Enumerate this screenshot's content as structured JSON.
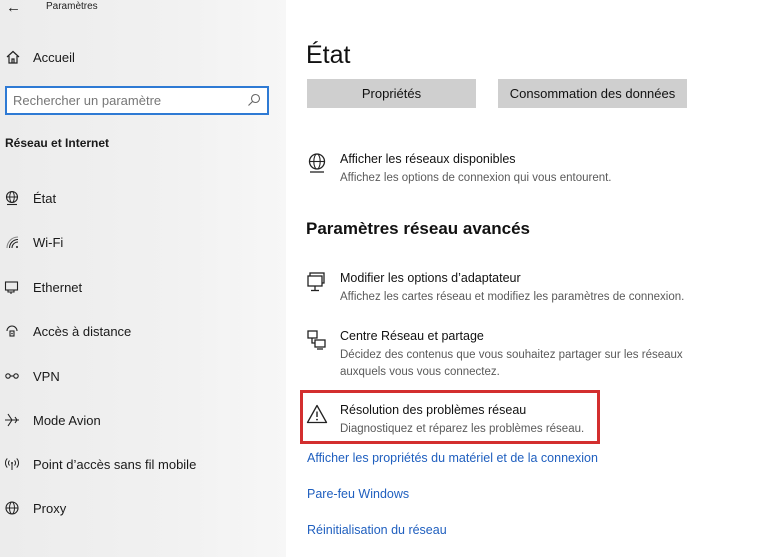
{
  "titlebar": {
    "back_icon": "back-arrow-icon",
    "title": "Paramètres"
  },
  "sidebar": {
    "home_label": "Accueil",
    "search_placeholder": "Rechercher un paramètre",
    "section": "Réseau et Internet",
    "items": [
      {
        "label": "État",
        "icon": "globe-status-icon"
      },
      {
        "label": "Wi-Fi",
        "icon": "wifi-icon"
      },
      {
        "label": "Ethernet",
        "icon": "ethernet-icon"
      },
      {
        "label": "Accès à distance",
        "icon": "dialup-icon"
      },
      {
        "label": "VPN",
        "icon": "vpn-icon"
      },
      {
        "label": "Mode Avion",
        "icon": "airplane-icon"
      },
      {
        "label": "Point d’accès sans fil mobile",
        "icon": "hotspot-icon"
      },
      {
        "label": "Proxy",
        "icon": "proxy-globe-icon"
      }
    ]
  },
  "main": {
    "title": "État",
    "buttons": {
      "properties": "Propriétés",
      "data_usage": "Consommation des données"
    },
    "available_networks": {
      "title": "Afficher les réseaux disponibles",
      "desc": "Affichez les options de connexion qui vous entourent."
    },
    "advanced_title": "Paramètres réseau avancés",
    "adapter": {
      "title": "Modifier les options d’adaptateur",
      "desc": "Affichez les cartes réseau et modifiez les paramètres de connexion."
    },
    "sharing": {
      "title": "Centre Réseau et partage",
      "desc": "Décidez des contenus que vous souhaitez partager sur les réseaux auxquels vous vous connectez."
    },
    "troubleshoot": {
      "title": "Résolution des problèmes réseau",
      "desc": "Diagnostiquez et réparez les problèmes réseau."
    },
    "links": {
      "hardware": "Afficher les propriétés du matériel et de la connexion",
      "firewall": "Pare-feu Windows",
      "reset": "Réinitialisation du réseau"
    }
  },
  "colors": {
    "accent": "#1f5fbf",
    "search_border": "#2e7ad4",
    "highlight": "#d32f2f",
    "button_bg": "#cfcfcf"
  }
}
